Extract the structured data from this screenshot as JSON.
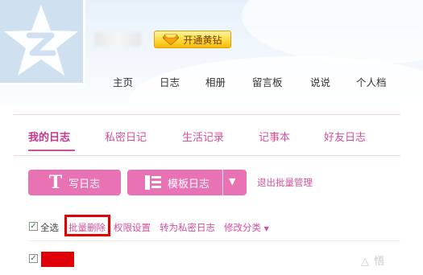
{
  "header": {
    "vip_button_label": "开通黄钻"
  },
  "topnav": {
    "items": [
      "主页",
      "日志",
      "相册",
      "留言板",
      "说说",
      "个人档"
    ]
  },
  "tabs": {
    "items": [
      "我的日志",
      "私密日记",
      "生活记录",
      "记事本",
      "好友日志"
    ],
    "active": "我的日志"
  },
  "actions": {
    "write_glyph": "T",
    "write_label": "写日志",
    "template_label": "模板日志",
    "exit_batch_label": "退出批量管理"
  },
  "batch_toolbar": {
    "select_all_label": "全选",
    "batch_delete_label": "批量删除",
    "permissions_label": "权限设置",
    "to_private_label": "转为私密日志",
    "change_category_label": "修改分类"
  },
  "watermark": "△ 悟",
  "colors": {
    "accent_pink": "#e872b4",
    "link_pink": "#d0509b",
    "highlight_red": "#e00000",
    "vip_gold": "#ffd83a"
  },
  "icons": {
    "avatar": "qq-star-logo",
    "vip": "diamond-icon",
    "write": "t-letter-icon",
    "template": "template-list-icon",
    "dropdown": "chevron-down-icon"
  }
}
